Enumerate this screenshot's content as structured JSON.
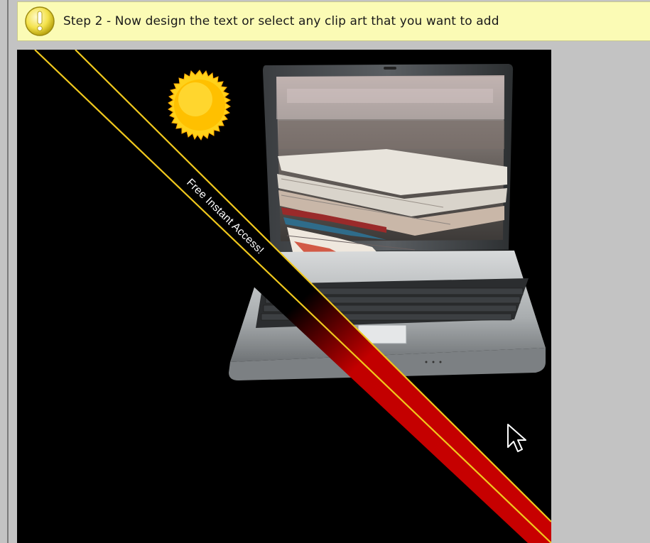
{
  "step_bar": {
    "text": "Step 2 - Now design the text or select any clip art that you want to add",
    "icon": "exclamation-icon"
  },
  "design_canvas": {
    "banner_text": "Free Instant Access!",
    "sun_icon": "sun-clipart",
    "main_image": "laptop-with-magazines",
    "colors": {
      "background": "#000000",
      "banner_red": "#c80000",
      "banner_border": "#f5d31f",
      "sun": "#ffc400"
    }
  },
  "cursor_icon": "mouse-pointer-icon"
}
